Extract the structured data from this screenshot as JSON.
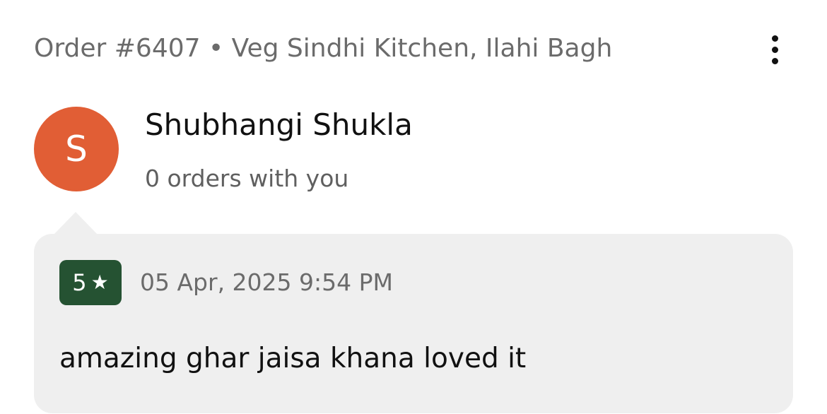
{
  "header": {
    "order_title": "Order #6407 • Veg Sindhi Kitchen, Ilahi Bagh",
    "more_icon": "more-vertical-icon"
  },
  "customer": {
    "avatar_initial": "S",
    "avatar_color": "#E15E35",
    "name": "Shubhangi Shukla",
    "order_count_text": "0 orders with you"
  },
  "review": {
    "rating": "5",
    "rating_icon": "★",
    "rating_badge_color": "#255232",
    "date": "05 Apr, 2025 9:54 PM",
    "text": "amazing ghar jaisa khana loved it",
    "card_color": "#EFEFEF"
  }
}
